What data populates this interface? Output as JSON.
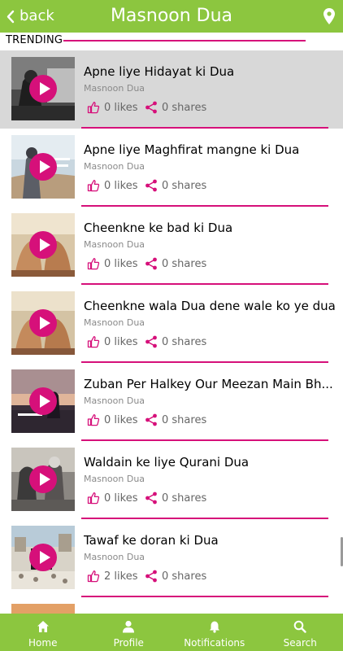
{
  "header": {
    "back_label": "back",
    "title": "Masnoon Dua",
    "bg_color": "#8cc63f"
  },
  "section": {
    "label": "TRENDING",
    "accent_color": "#d6107a"
  },
  "items": [
    {
      "title": "Apne liye Hidayat ki Dua",
      "category": "Masnoon Dua",
      "likes": "0 likes",
      "shares": "0 shares",
      "selected": true,
      "thumb": "grayscale-prayer"
    },
    {
      "title": "Apne liye Maghfirat mangne ki Dua",
      "category": "Masnoon Dua",
      "likes": "0 likes",
      "shares": "0 shares",
      "selected": false,
      "thumb": "sky-prayer"
    },
    {
      "title": "Cheenkne ke bad ki Dua",
      "category": "Masnoon Dua",
      "likes": "0 likes",
      "shares": "0 shares",
      "selected": false,
      "thumb": "hands-dua"
    },
    {
      "title": "Cheenkne wala Dua dene wale ko ye dua",
      "category": "Masnoon Dua",
      "likes": "0 likes",
      "shares": "0 shares",
      "selected": false,
      "thumb": "hands-dua"
    },
    {
      "title": "Zuban Per Halkey Our Meezan Main Bh...",
      "category": "Masnoon Dua",
      "likes": "0 likes",
      "shares": "0 shares",
      "selected": false,
      "thumb": "sunset-prayer"
    },
    {
      "title": "Waldain ke liye Qurani Dua",
      "category": "Masnoon Dua",
      "likes": "0 likes",
      "shares": "0 shares",
      "selected": false,
      "thumb": "parents"
    },
    {
      "title": "Tawaf ke doran ki Dua",
      "category": "Masnoon Dua",
      "likes": "2 likes",
      "shares": "0 shares",
      "selected": false,
      "thumb": "kaaba"
    }
  ],
  "bottom_nav": [
    {
      "label": "Home",
      "icon": "home-icon"
    },
    {
      "label": "Profile",
      "icon": "profile-icon"
    },
    {
      "label": "Notifications",
      "icon": "bell-icon"
    },
    {
      "label": "Search",
      "icon": "search-icon"
    }
  ],
  "icons": {
    "back": "chevron-left-icon",
    "location": "map-pin-icon",
    "like": "thumbs-up-icon",
    "share": "share-icon",
    "play": "play-icon"
  }
}
